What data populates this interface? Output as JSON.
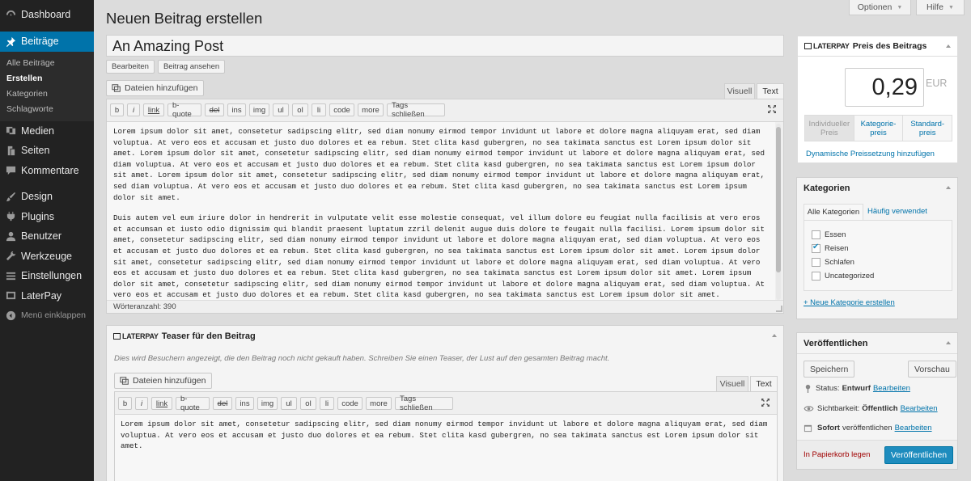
{
  "sidebar": {
    "items": [
      {
        "label": "Dashboard",
        "icon": "dashboard-icon"
      },
      {
        "label": "Beiträge",
        "icon": "pin-icon",
        "active": true
      },
      {
        "label": "Medien",
        "icon": "media-icon"
      },
      {
        "label": "Seiten",
        "icon": "pages-icon"
      },
      {
        "label": "Kommentare",
        "icon": "comment-icon"
      },
      {
        "label": "Design",
        "icon": "brush-icon"
      },
      {
        "label": "Plugins",
        "icon": "plugin-icon"
      },
      {
        "label": "Benutzer",
        "icon": "user-icon"
      },
      {
        "label": "Werkzeuge",
        "icon": "wrench-icon"
      },
      {
        "label": "Einstellungen",
        "icon": "settings-icon"
      },
      {
        "label": "LaterPay",
        "icon": "laterpay-icon"
      }
    ],
    "submenu": [
      "Alle Beiträge",
      "Erstellen",
      "Kategorien",
      "Schlagworte"
    ],
    "collapse_label": "Menü einklappen"
  },
  "top": {
    "options": "Optionen",
    "help": "Hilfe"
  },
  "page_title": "Neuen Beitrag erstellen",
  "post_title": "An Amazing Post",
  "title_buttons": {
    "edit": "Bearbeiten",
    "view": "Beitrag ansehen"
  },
  "editor": {
    "media_button": "Dateien hinzufügen",
    "tab_visual": "Visuell",
    "tab_text": "Text",
    "quicktags": [
      "b",
      "i",
      "link",
      "b-quote",
      "del",
      "ins",
      "img",
      "ul",
      "ol",
      "li",
      "code",
      "more",
      "Tags schließen"
    ],
    "paragraph1": "Lorem ipsum dolor sit amet, consetetur sadipscing elitr, sed diam nonumy eirmod tempor invidunt ut labore et dolore magna aliquyam erat, sed diam voluptua. At vero eos et accusam et justo duo dolores et ea rebum. Stet clita kasd gubergren, no sea takimata sanctus est Lorem ipsum dolor sit amet. Lorem ipsum dolor sit amet, consetetur sadipscing elitr, sed diam nonumy eirmod tempor invidunt ut labore et dolore magna aliquyam erat, sed diam voluptua. At vero eos et accusam et justo duo dolores et ea rebum. Stet clita kasd gubergren, no sea takimata sanctus est Lorem ipsum dolor sit amet. Lorem ipsum dolor sit amet, consetetur sadipscing elitr, sed diam nonumy eirmod tempor invidunt ut labore et dolore magna aliquyam erat, sed diam voluptua. At vero eos et accusam et justo duo dolores et ea rebum. Stet clita kasd gubergren, no sea takimata sanctus est Lorem ipsum dolor sit amet.",
    "paragraph2": "Duis autem vel eum iriure dolor in hendrerit in vulputate velit esse molestie consequat, vel illum dolore eu feugiat nulla facilisis at vero eros et accumsan et iusto odio dignissim qui blandit praesent luptatum zzril delenit augue duis dolore te feugait nulla facilisi. Lorem ipsum dolor sit amet, consetetur sadipscing elitr, sed diam nonumy eirmod tempor invidunt ut labore et dolore magna aliquyam erat, sed diam voluptua. At vero eos et accusam et justo duo dolores et ea rebum. Stet clita kasd gubergren, no sea takimata sanctus est Lorem ipsum dolor sit amet. Lorem ipsum dolor sit amet, consetetur sadipscing elitr, sed diam nonumy eirmod tempor invidunt ut labore et dolore magna aliquyam erat, sed diam voluptua. At vero eos et accusam et justo duo dolores et ea rebum. Stet clita kasd gubergren, no sea takimata sanctus est Lorem ipsum dolor sit amet. Lorem ipsum dolor sit amet, consetetur sadipscing elitr, sed diam nonumy eirmod tempor invidunt ut labore et dolore magna aliquyam erat, sed diam voluptua. At vero eos et accusam et justo duo dolores et ea rebum. Stet clita kasd gubergren, no sea takimata sanctus est Lorem ipsum dolor sit amet.",
    "word_count": "Wörteranzahl: 390"
  },
  "teaser": {
    "brand": "LATERPAY",
    "title": "Teaser für den Beitrag",
    "hint": "Dies wird Besuchern angezeigt, die den Beitrag noch nicht gekauft haben. Schreiben Sie einen Teaser, der Lust auf den gesamten Beitrag macht.",
    "text": "Lorem ipsum dolor sit amet, consetetur sadipscing elitr, sed diam nonumy eirmod tempor invidunt ut labore et dolore magna aliquyam erat, sed diam voluptua. At vero eos et accusam et justo duo dolores et ea rebum. Stet clita kasd gubergren, no sea takimata sanctus est Lorem ipsum dolor sit amet."
  },
  "price_box": {
    "brand": "LATERPAY",
    "title": "Preis des Beitrags",
    "price": "0,29",
    "currency": "EUR",
    "options": [
      {
        "line1": "Individueller",
        "line2": "Preis"
      },
      {
        "line1": "Kategorie-",
        "line2": "preis"
      },
      {
        "line1": "Standard-",
        "line2": "preis"
      }
    ],
    "dynamic_link": "Dynamische Preissetzung hinzufügen"
  },
  "categories": {
    "title": "Kategorien",
    "tab_all": "Alle Kategorien",
    "tab_popular": "Häufig verwendet",
    "items": [
      {
        "label": "Essen",
        "checked": false
      },
      {
        "label": "Reisen",
        "checked": true
      },
      {
        "label": "Schlafen",
        "checked": false
      },
      {
        "label": "Uncategorized",
        "checked": false
      }
    ],
    "add_link": "+ Neue Kategorie erstellen"
  },
  "publish": {
    "title": "Veröffentlichen",
    "save": "Speichern",
    "preview": "Vorschau",
    "status_label": "Status:",
    "status_value": "Entwurf",
    "visibility_label": "Sichtbarkeit:",
    "visibility_value": "Öffentlich",
    "schedule_value": "Sofort",
    "schedule_label": "veröffentlichen",
    "edit_link": "Bearbeiten",
    "trash": "In Papierkorb legen",
    "publish_button": "Veröffentlichen"
  },
  "colors": {
    "accent": "#0073aa",
    "sidebar": "#222222",
    "trash": "#a00000"
  }
}
